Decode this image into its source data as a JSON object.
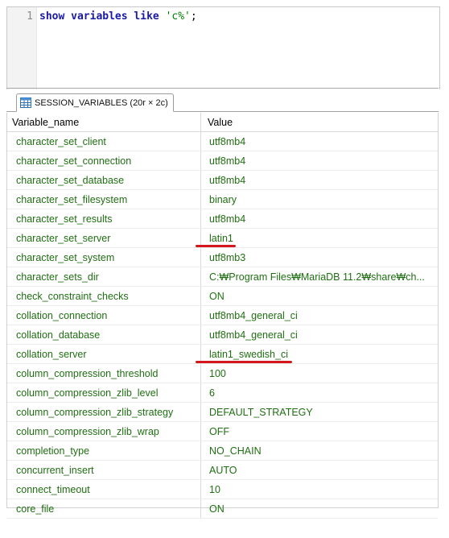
{
  "editor": {
    "line_number": "1",
    "code": {
      "kw1": "show",
      "kw2": "variables",
      "kw3": "like",
      "str": "'c%'",
      "end": ";"
    }
  },
  "result_tab": {
    "label": "SESSION_VARIABLES (20r × 2c)",
    "icon": "table-grid-icon"
  },
  "grid": {
    "columns": [
      "Variable_name",
      "Value"
    ],
    "rows": [
      [
        "character_set_client",
        "utf8mb4"
      ],
      [
        "character_set_connection",
        "utf8mb4"
      ],
      [
        "character_set_database",
        "utf8mb4"
      ],
      [
        "character_set_filesystem",
        "binary"
      ],
      [
        "character_set_results",
        "utf8mb4"
      ],
      [
        "character_set_server",
        "latin1"
      ],
      [
        "character_set_system",
        "utf8mb3"
      ],
      [
        "character_sets_dir",
        "C:₩Program Files₩MariaDB 11.2₩share₩ch..."
      ],
      [
        "check_constraint_checks",
        "ON"
      ],
      [
        "collation_connection",
        "utf8mb4_general_ci"
      ],
      [
        "collation_database",
        "utf8mb4_general_ci"
      ],
      [
        "collation_server",
        "latin1_swedish_ci"
      ],
      [
        "column_compression_threshold",
        "100"
      ],
      [
        "column_compression_zlib_level",
        "6"
      ],
      [
        "column_compression_zlib_strategy",
        "DEFAULT_STRATEGY"
      ],
      [
        "column_compression_zlib_wrap",
        "OFF"
      ],
      [
        "completion_type",
        "NO_CHAIN"
      ],
      [
        "concurrent_insert",
        "AUTO"
      ],
      [
        "connect_timeout",
        "10"
      ],
      [
        "core_file",
        "ON"
      ]
    ]
  },
  "colors": {
    "keyword": "#1a1aa6",
    "string": "#008000",
    "cell_text": "#1f6f12",
    "annotation_red": "#d4161d"
  }
}
